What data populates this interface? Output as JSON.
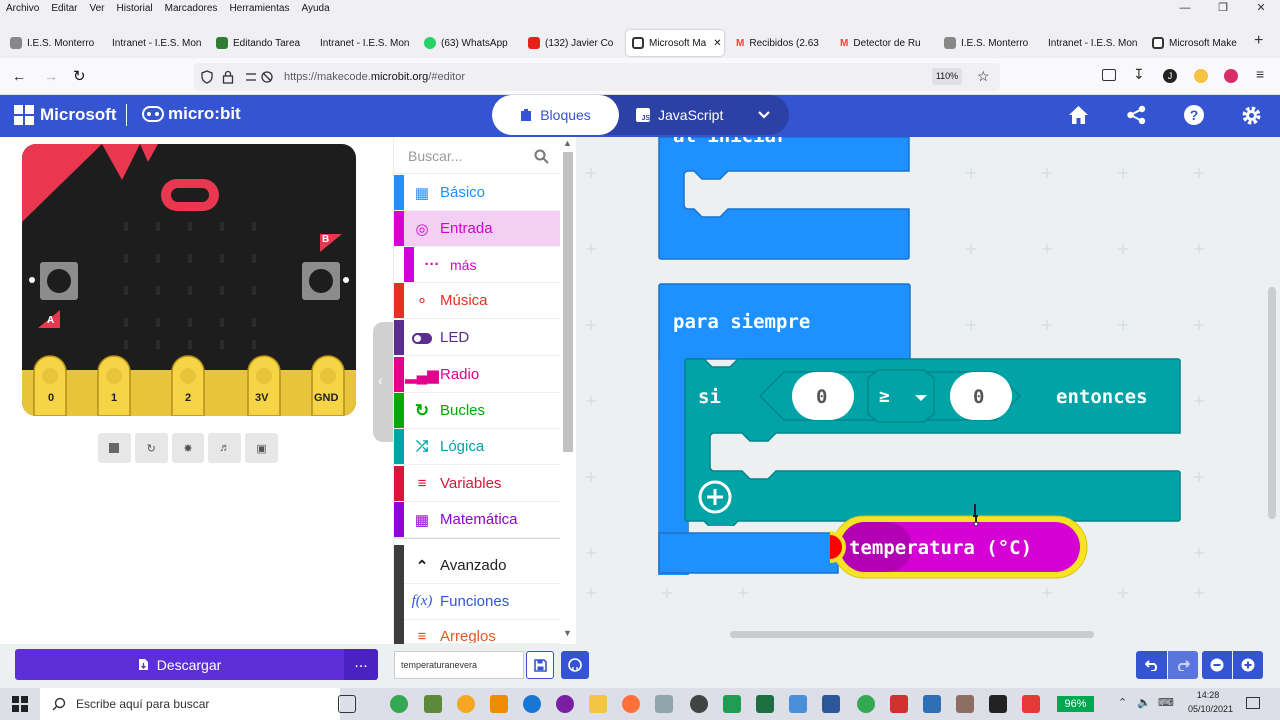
{
  "browser": {
    "menu": [
      "Archivo",
      "Editar",
      "Ver",
      "Historial",
      "Marcadores",
      "Herramientas",
      "Ayuda"
    ],
    "tabs": [
      {
        "label": "I.E.S. Monterro",
        "color": "#888"
      },
      {
        "label": "Intranet - I.E.S. Mon",
        "color": "#888"
      },
      {
        "label": "Editando Tarea",
        "color": "#2e7d32"
      },
      {
        "label": "Intranet - I.E.S. Mon",
        "color": "#888"
      },
      {
        "label": "(63) WhatsApp",
        "color": "#25d366"
      },
      {
        "label": "(132) Javier Co",
        "color": "#e62117"
      },
      {
        "label": "Microsoft Ma",
        "color": "#333"
      },
      {
        "label": "Recibidos (2.63",
        "color": "#ea4335"
      },
      {
        "label": "Detector de Ru",
        "color": "#ea4335"
      },
      {
        "label": "I.E.S. Monterro",
        "color": "#888"
      },
      {
        "label": "Intranet - I.E.S. Mon",
        "color": "#888"
      },
      {
        "label": "Microsoft Make",
        "color": "#333"
      }
    ],
    "url_prefix": "https://makecode.",
    "url_domain": "microbit.org",
    "url_suffix": "/#editor",
    "zoom": "110%"
  },
  "header": {
    "brand": "Microsoft",
    "product": "micro:bit",
    "blocks_label": "Bloques",
    "js_label": "JavaScript"
  },
  "simulator": {
    "pins": [
      "0",
      "1",
      "2",
      "3V",
      "GND"
    ],
    "button_a": "A",
    "button_b": "B"
  },
  "toolbox": {
    "search_placeholder": "Buscar...",
    "categories": [
      {
        "label": "Básico",
        "color": "#1e90ff",
        "icon": "grid-icon"
      },
      {
        "label": "Entrada",
        "color": "#d400d4",
        "icon": "target-icon"
      },
      {
        "label": "más",
        "color": "#d400d4",
        "icon": "dots-icon"
      },
      {
        "label": "Música",
        "color": "#e63022",
        "icon": "headphones-icon"
      },
      {
        "label": "LED",
        "color": "#5c2d91",
        "icon": "toggle-icon"
      },
      {
        "label": "Radio",
        "color": "#e3008c",
        "icon": "bars-icon"
      },
      {
        "label": "Bucles",
        "color": "#00aa00",
        "icon": "refresh-icon"
      },
      {
        "label": "Lógica",
        "color": "#00a4a6",
        "icon": "shuffle-icon"
      },
      {
        "label": "Variables",
        "color": "#dc143c",
        "icon": "lines-icon"
      },
      {
        "label": "Matemática",
        "color": "#9400d3",
        "icon": "calculator-icon"
      },
      {
        "label": "Avanzado",
        "color": "#3c3c3c",
        "icon": "chevron-up-icon"
      },
      {
        "label": "Funciones",
        "color": "#3455db",
        "icon": "function-icon"
      },
      {
        "label": "Arreglos",
        "color": "#e65722",
        "icon": "list-icon"
      }
    ]
  },
  "workspace": {
    "on_start": "al iniciar",
    "forever": "para siempre",
    "if_label": "si",
    "then_label": "entonces",
    "left_value": "0",
    "operator": "≥",
    "right_value": "0",
    "dragged_block": "temperatura (°C)"
  },
  "footer": {
    "download": "Descargar",
    "more": "...",
    "project_name": "temperaturanevera"
  },
  "taskbar": {
    "search_placeholder": "Escribe aquí para buscar",
    "battery": "96%",
    "time": "14:28",
    "date": "05/10/2021"
  }
}
